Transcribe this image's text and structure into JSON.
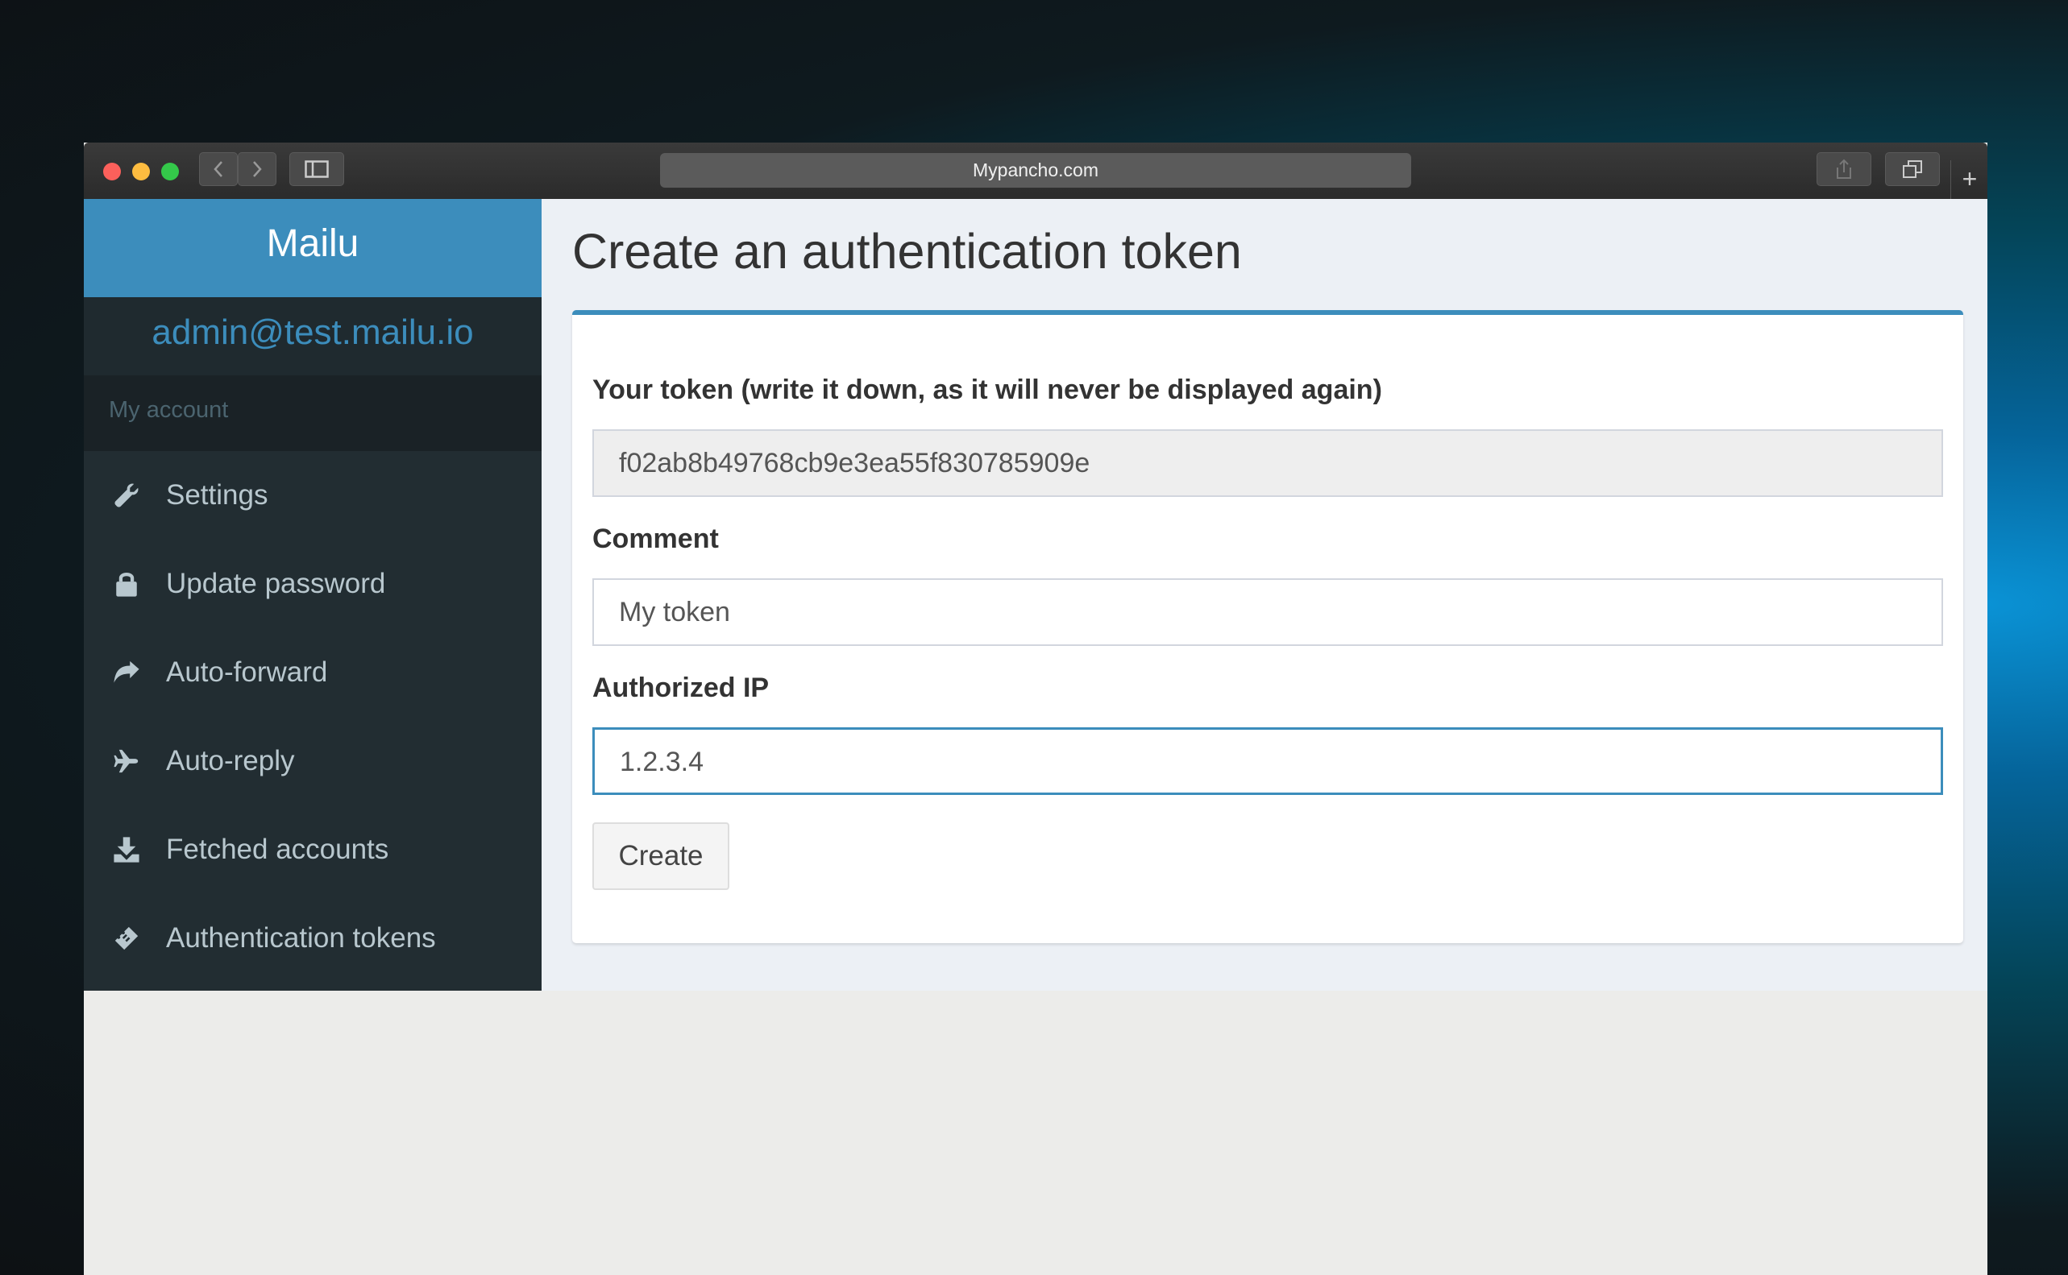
{
  "browser": {
    "url": "Mypancho.com"
  },
  "sidebar": {
    "brand": "Mailu",
    "user_email": "admin@test.mailu.io",
    "section_header": "My account",
    "items": [
      {
        "label": "Settings",
        "icon": "wrench-icon"
      },
      {
        "label": "Update password",
        "icon": "lock-icon"
      },
      {
        "label": "Auto-forward",
        "icon": "share-arrow-icon"
      },
      {
        "label": "Auto-reply",
        "icon": "plane-icon"
      },
      {
        "label": "Fetched accounts",
        "icon": "download-icon"
      },
      {
        "label": "Authentication tokens",
        "icon": "ticket-icon"
      }
    ]
  },
  "main": {
    "title": "Create an authentication token",
    "form": {
      "token_label": "Your token (write it down, as it will never be displayed again)",
      "token_value": "f02ab8b49768cb9e3ea55f830785909e",
      "comment_label": "Comment",
      "comment_value": "My token",
      "ip_label": "Authorized IP",
      "ip_value": "1.2.3.4",
      "submit_label": "Create"
    }
  },
  "colors": {
    "brand": "#3c8dbc",
    "sidebar_bg": "#222d32",
    "content_bg": "#ecf0f5"
  }
}
